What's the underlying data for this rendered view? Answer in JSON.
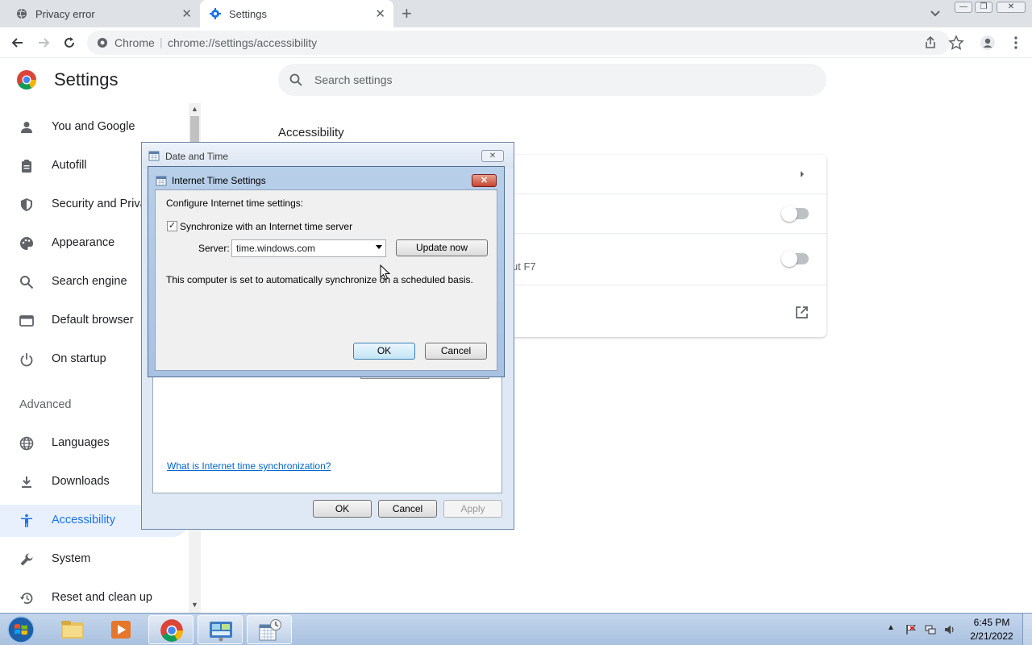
{
  "browser": {
    "tabs": [
      {
        "label": "Privacy error",
        "active": false
      },
      {
        "label": "Settings",
        "active": true
      }
    ],
    "omnibox": {
      "site_label": "Chrome",
      "separator": "|",
      "url": "chrome://settings/accessibility"
    }
  },
  "settings": {
    "title": "Settings",
    "search_placeholder": "Search settings",
    "nav": [
      {
        "label": "You and Google",
        "icon": "person-icon"
      },
      {
        "label": "Autofill",
        "icon": "clipboard-icon"
      },
      {
        "label": "Security and Priva",
        "icon": "shield-icon"
      },
      {
        "label": "Appearance",
        "icon": "palette-icon"
      },
      {
        "label": "Search engine",
        "icon": "search-icon"
      },
      {
        "label": "Default browser",
        "icon": "browser-icon"
      },
      {
        "label": "On startup",
        "icon": "power-icon"
      }
    ],
    "advanced_label": "Advanced",
    "advanced_nav": [
      {
        "label": "Languages",
        "icon": "globe-icon"
      },
      {
        "label": "Downloads",
        "icon": "download-icon"
      },
      {
        "label": "Accessibility",
        "icon": "accessibility-icon",
        "selected": true
      },
      {
        "label": "System",
        "icon": "wrench-icon"
      },
      {
        "label": "Reset and clean up",
        "icon": "restore-icon"
      }
    ],
    "section_title": "Accessibility",
    "partial_text": "ut F7",
    "toggles": [
      false,
      false
    ]
  },
  "date_time_dialog": {
    "title": "Date and Time",
    "close_label": "✕",
    "link_text": "What is Internet time synchronization?",
    "ok_label": "OK",
    "cancel_label": "Cancel",
    "apply_label": "Apply"
  },
  "internet_time_dialog": {
    "title": "Internet Time Settings",
    "close_label": "✕",
    "heading": "Configure Internet time settings:",
    "sync_checkbox_label": "Synchronize with an Internet time server",
    "sync_checked": true,
    "server_label": "Server:",
    "server_value": "time.windows.com",
    "update_now_label": "Update now",
    "status_text": "This computer is set to automatically synchronize on a scheduled basis.",
    "ok_label": "OK",
    "cancel_label": "Cancel"
  },
  "taskbar": {
    "items": [
      "start-button",
      "file-explorer",
      "media-player",
      "chrome",
      "control-panel",
      "date-time"
    ],
    "clock_time": "6:45 PM",
    "clock_date": "2/21/2022"
  },
  "colors": {
    "accent": "#1a73e8",
    "selected_bg": "#e8f0fe",
    "link": "#0066cc"
  }
}
